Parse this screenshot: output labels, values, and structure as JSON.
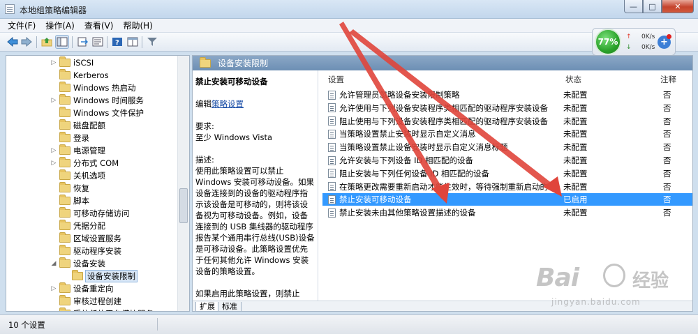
{
  "window": {
    "title": "本地组策略编辑器",
    "min_glyph": "—",
    "max_glyph": "□",
    "close_glyph": "✕"
  },
  "menu": [
    "文件(F)",
    "操作(A)",
    "查看(V)",
    "帮助(H)"
  ],
  "toolbar": {
    "icons": [
      "back-arrow-icon",
      "forward-arrow-icon",
      "up-folder-icon",
      "show-hide-tree-icon",
      "export-list-icon",
      "properties-icon",
      "help-icon",
      "extended-view-icon",
      "filter-icon"
    ]
  },
  "net_widget": {
    "percent": "77%",
    "up_arrow": "↑",
    "down_arrow": "↓",
    "up_speed": "0K/s",
    "down_speed": "0K/s",
    "plus": "+"
  },
  "tree": {
    "items": [
      {
        "label": "iSCSI",
        "expander": "▷",
        "indent": 1
      },
      {
        "label": "Kerberos",
        "expander": "",
        "indent": 1
      },
      {
        "label": "Windows 热启动",
        "expander": "",
        "indent": 1
      },
      {
        "label": "Windows 时间服务",
        "expander": "▷",
        "indent": 1
      },
      {
        "label": "Windows 文件保护",
        "expander": "",
        "indent": 1
      },
      {
        "label": "磁盘配额",
        "expander": "",
        "indent": 1
      },
      {
        "label": "登录",
        "expander": "",
        "indent": 1
      },
      {
        "label": "电源管理",
        "expander": "▷",
        "indent": 1
      },
      {
        "label": "分布式 COM",
        "expander": "▷",
        "indent": 1
      },
      {
        "label": "关机选项",
        "expander": "",
        "indent": 1
      },
      {
        "label": "恢复",
        "expander": "",
        "indent": 1
      },
      {
        "label": "脚本",
        "expander": "",
        "indent": 1
      },
      {
        "label": "可移动存储访问",
        "expander": "",
        "indent": 1
      },
      {
        "label": "凭据分配",
        "expander": "",
        "indent": 1
      },
      {
        "label": "区域设置服务",
        "expander": "",
        "indent": 1
      },
      {
        "label": "驱动程序安装",
        "expander": "",
        "indent": 1
      },
      {
        "label": "设备安装",
        "expander": "◢",
        "indent": 1
      },
      {
        "label": "设备安装限制",
        "expander": "",
        "indent": 2,
        "selected": true
      },
      {
        "label": "设备重定向",
        "expander": "▷",
        "indent": 1
      },
      {
        "label": "审核过程创建",
        "expander": "",
        "indent": 1
      },
      {
        "label": "受信任的平台模块服务",
        "expander": "",
        "indent": 1
      }
    ]
  },
  "right_header": "设备安装限制",
  "description": {
    "title": "禁止安装可移动设备",
    "edit_prefix": "编辑",
    "edit_link": "策略设置",
    "requirement_label": "要求:",
    "requirement_value": "至少 Windows Vista",
    "desc_label": "描述:",
    "desc_text": "使用此策略设置可以禁止 Windows 安装可移动设备。如果设备连接到的设备的驱动程序指示该设备是可移动的，则将该设备视为可移动设备。例如，设备连接到的 USB 集线器的驱动程序报告某个通用串行总线(USB)设备是可移动设备。此策略设置优先于任何其他允许 Windows 安装设备的策略设置。",
    "desc_text2": "如果启用此策略设置，则禁止 Windows 安装可移动设备，并且"
  },
  "columns": {
    "setting": "设置",
    "state": "状态",
    "comment": "注释"
  },
  "rows": [
    {
      "name": "允许管理员忽略设备安装限制策略",
      "state": "未配置",
      "comment": "否"
    },
    {
      "name": "允许使用与下列设备安装程序类相匹配的驱动程序安装设备",
      "state": "未配置",
      "comment": "否"
    },
    {
      "name": "阻止使用与下列设备安装程序类相匹配的驱动程序安装设备",
      "state": "未配置",
      "comment": "否"
    },
    {
      "name": "当策略设置禁止安装时显示自定义消息",
      "state": "未配置",
      "comment": "否"
    },
    {
      "name": "当策略设置禁止设备安装时显示自定义消息标题",
      "state": "未配置",
      "comment": "否"
    },
    {
      "name": "允许安装与下列设备 ID 相匹配的设备",
      "state": "未配置",
      "comment": "否"
    },
    {
      "name": "阻止安装与下列任何设备 ID 相匹配的设备",
      "state": "未配置",
      "comment": "否"
    },
    {
      "name": "在策略更改需要重新启动才能生效时，等待强制重新启动的...",
      "state": "未配置",
      "comment": "否"
    },
    {
      "name": "禁止安装可移动设备",
      "state": "已启用",
      "comment": "否",
      "selected": true
    },
    {
      "name": "禁止安装未由其他策略设置描述的设备",
      "state": "未配置",
      "comment": "否"
    }
  ],
  "tabs": [
    "扩展",
    "标准"
  ],
  "status": "10 个设置",
  "watermark": {
    "main": "Bai",
    "cn": "经验",
    "sub": "jingyan.baidu.com"
  },
  "colors": {
    "accent_selected": "#3399ff",
    "arrow": "#e0453b",
    "header": "#7394b8"
  }
}
